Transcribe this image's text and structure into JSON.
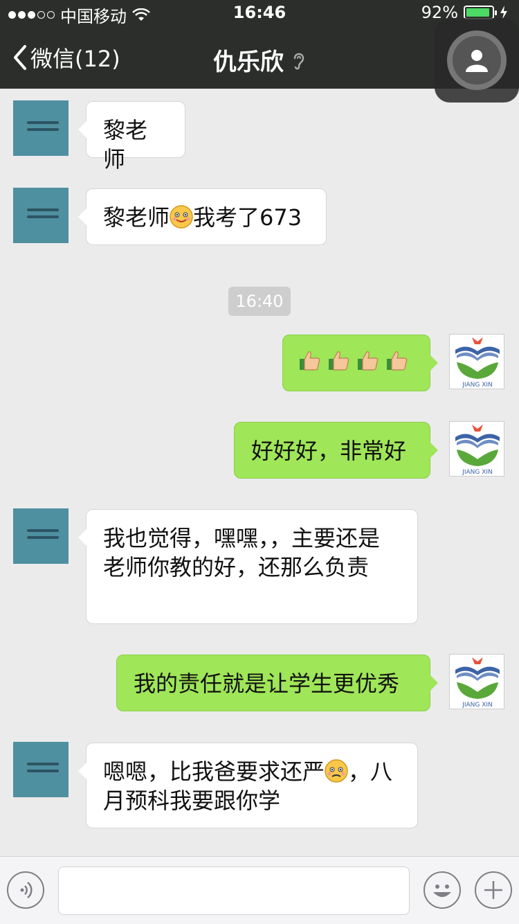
{
  "status": {
    "carrier": "中国移动",
    "time": "16:46",
    "battery_text": "92%",
    "battery_level": 0.92
  },
  "nav": {
    "back_label": "微信(12)",
    "title": "仇乐欣"
  },
  "messages": {
    "m1": "黎老师",
    "m2a": "黎老师",
    "m2b": "我考了673",
    "timestamp": "16:40",
    "m4": "好好好，非常好",
    "m5": "我也觉得，嘿嘿，，主要还是老师你教的好，还那么负责",
    "m6": "我的责任就是让学生更优秀",
    "m7a": "嗯嗯，比我爸要求还严",
    "m7b": "，八月预科我要跟你学"
  },
  "avatar_text": {
    "right_logo": "JIANG XIN"
  },
  "icons": {
    "emoji_smile": "smile-emoji",
    "emoji_thumbs": "thumbs-up-emoji",
    "emoji_worried": "worried-emoji"
  },
  "colors": {
    "navbar": "#2b2e2b",
    "outgoing_bubble": "#9fe658",
    "incoming_bubble": "#ffffff",
    "chat_bg": "#ebebeb"
  },
  "input": {
    "value": ""
  }
}
